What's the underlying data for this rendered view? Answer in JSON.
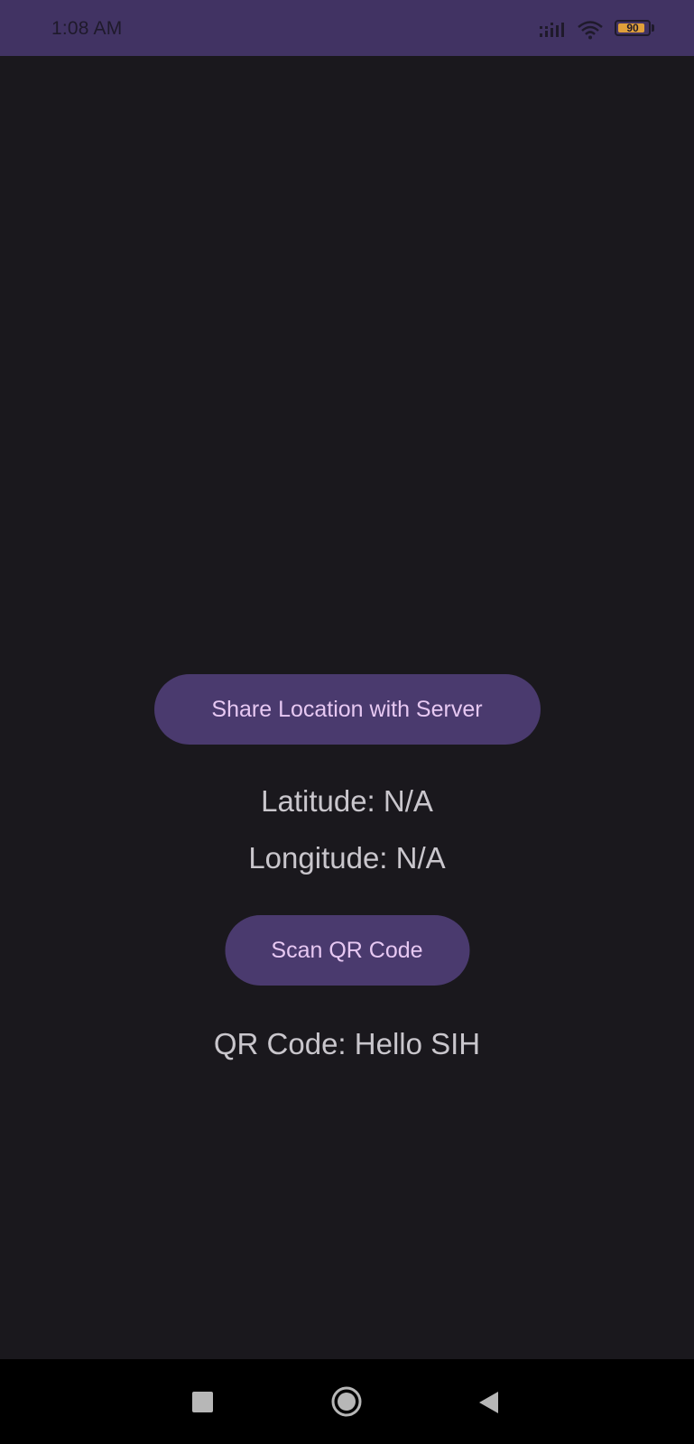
{
  "status_bar": {
    "time": "1:08 AM",
    "battery_level": "90",
    "battery_fraction": 0.9,
    "icons": [
      "signal-icon",
      "wifi-icon",
      "battery-icon"
    ],
    "background_color": "#413363"
  },
  "main": {
    "share_button_label": "Share Location with Server",
    "latitude_text": "Latitude: N/A",
    "longitude_text": "Longitude: N/A",
    "scan_button_label": "Scan QR Code",
    "qr_result_text": "QR Code: Hello SIH",
    "background_color": "#1a181d",
    "button_color": "#4a3a6e",
    "button_text_color": "#e7c8f2"
  },
  "nav_bar": {
    "buttons": [
      "recent-apps-icon",
      "home-icon",
      "back-icon"
    ]
  }
}
